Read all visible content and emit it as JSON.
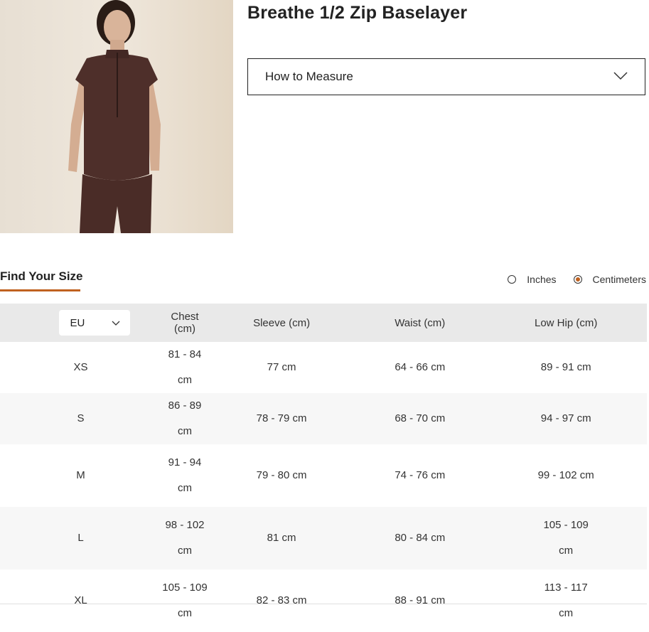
{
  "product": {
    "title": "Breathe 1/2 Zip Baselayer",
    "image_alt": "Model wearing brown short-sleeve half-zip baselayer"
  },
  "measure": {
    "label": "How to Measure"
  },
  "find": {
    "title": "Find Your Size"
  },
  "units": {
    "options": [
      "Inches",
      "Centimeters"
    ],
    "selected": "Centimeters"
  },
  "table": {
    "region_select": "EU",
    "headers": [
      "Chest (cm)",
      "Sleeve (cm)",
      "Waist (cm)",
      "Low Hip (cm)"
    ],
    "rows": [
      {
        "size": "XS",
        "chest": "81 - 84 cm",
        "sleeve": "77 cm",
        "waist": "64 - 66 cm",
        "hip": "89 - 91 cm"
      },
      {
        "size": "S",
        "chest": "86 - 89 cm",
        "sleeve": "78 - 79 cm",
        "waist": "68 - 70 cm",
        "hip": "94 - 97 cm"
      },
      {
        "size": "M",
        "chest": "91 - 94 cm",
        "sleeve": "79 - 80 cm",
        "waist": "74 - 76 cm",
        "hip": "99 - 102 cm"
      },
      {
        "size": "L",
        "chest": "98 - 102 cm",
        "sleeve": "81 cm",
        "waist": "80 - 84 cm",
        "hip": "105 - 109 cm"
      },
      {
        "size": "XL",
        "chest": "105 - 109 cm",
        "sleeve": "82 - 83 cm",
        "waist": "88 - 91 cm",
        "hip": "113 - 117 cm"
      }
    ]
  },
  "colors": {
    "accent": "#c0611f",
    "header_bg": "#e9e9e9",
    "garment": "#4e2f2a"
  }
}
